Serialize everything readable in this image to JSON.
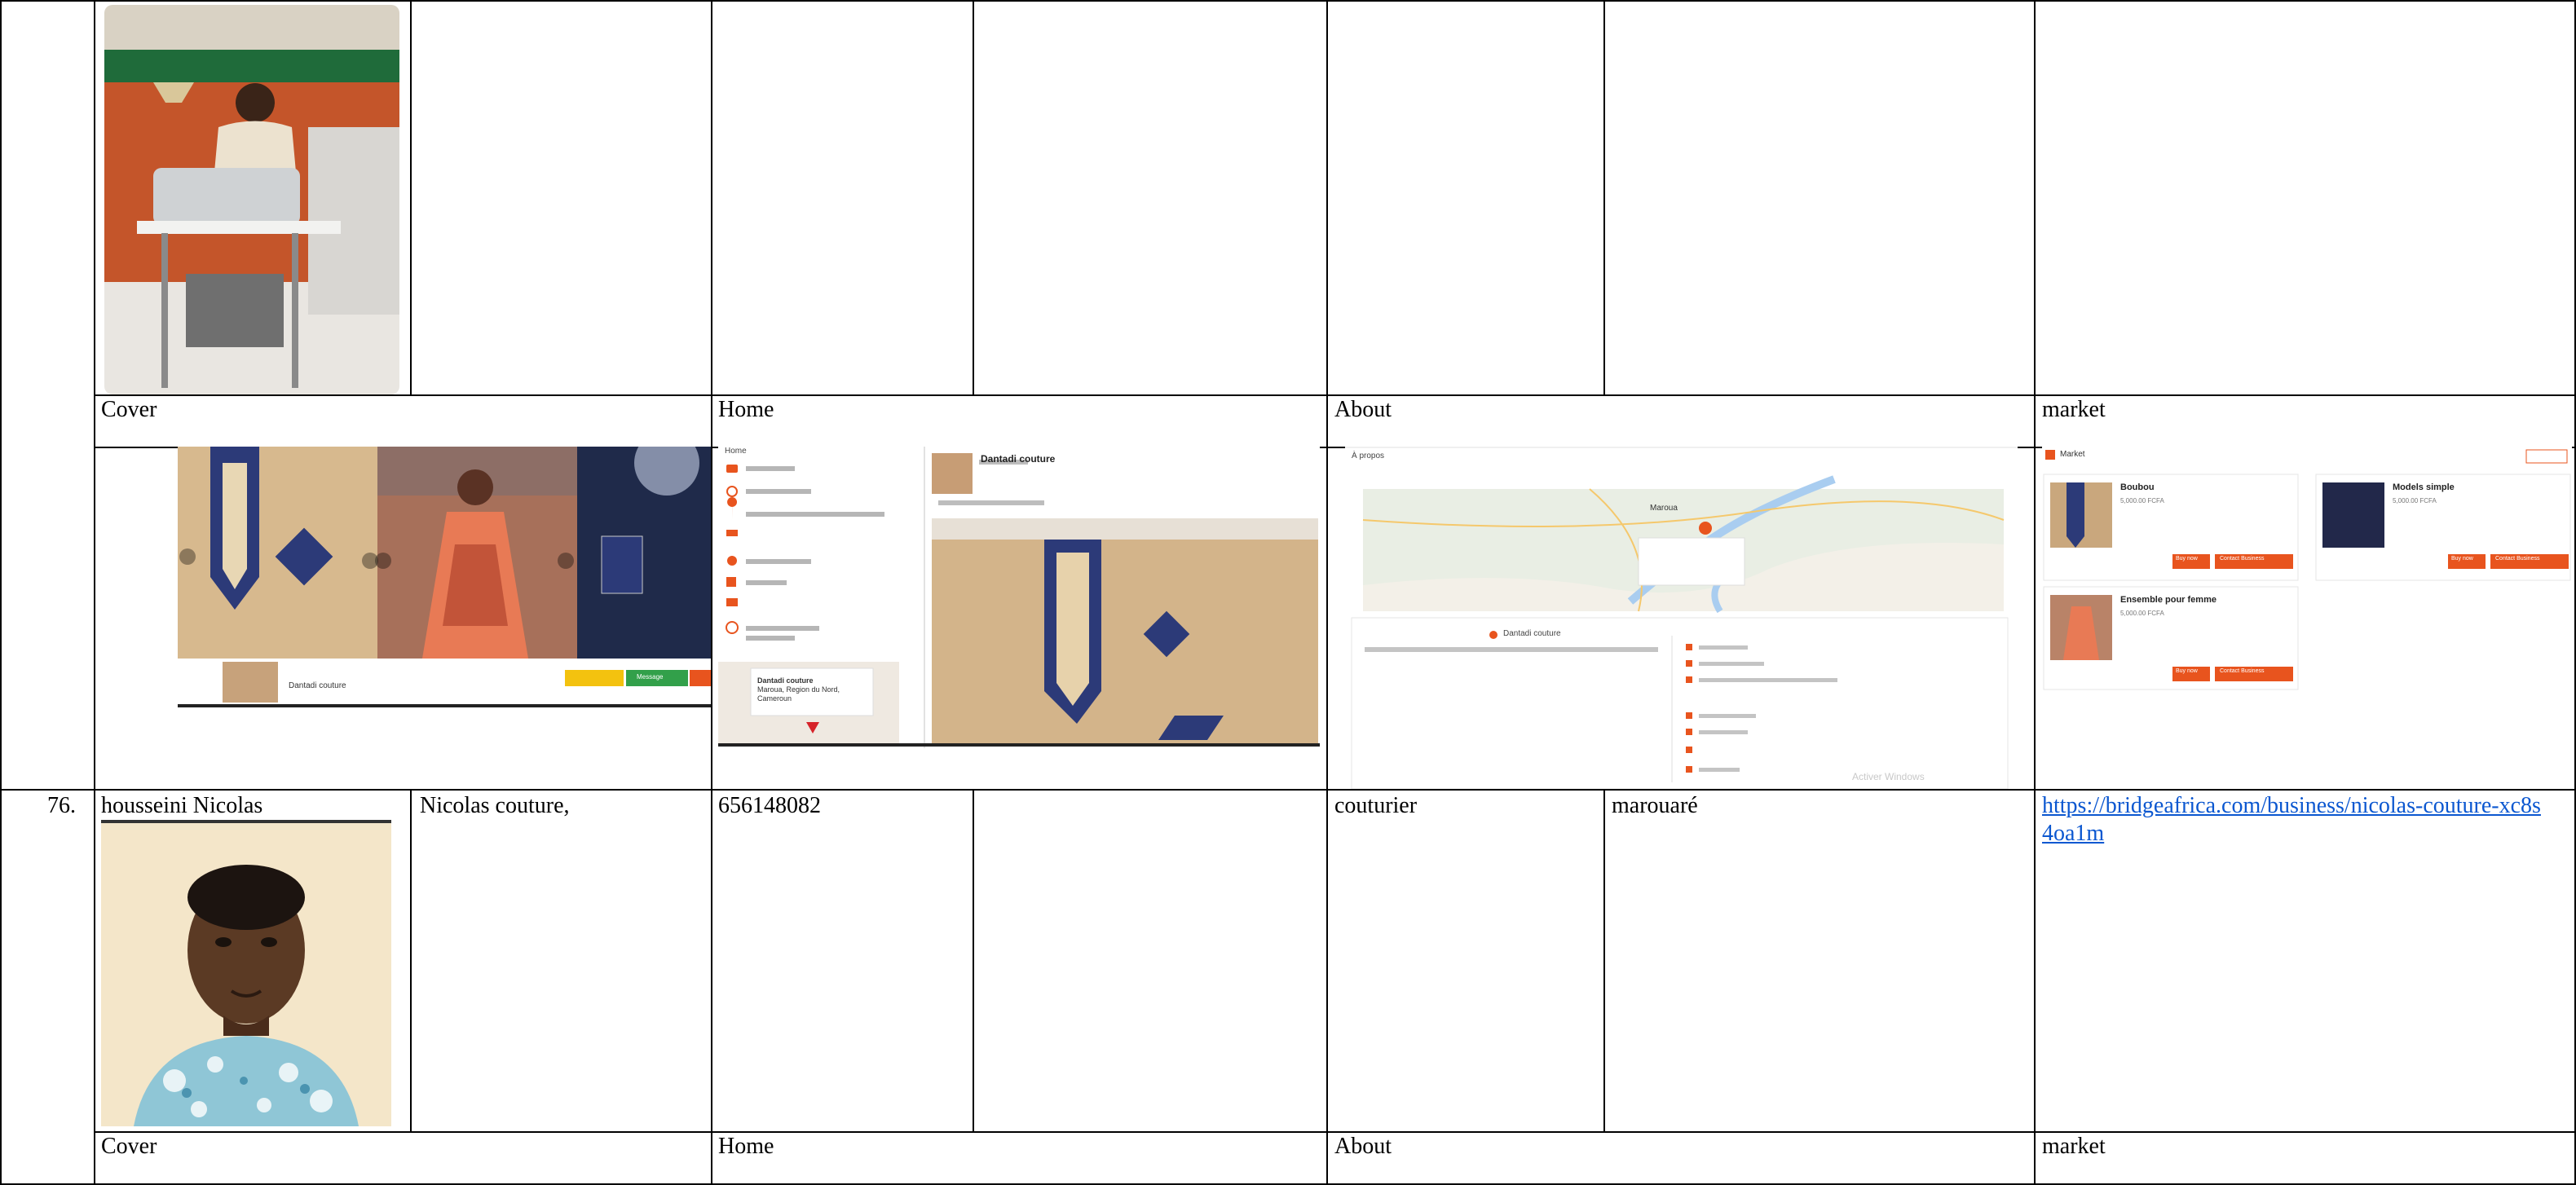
{
  "row_top": {
    "tabs": [
      "Cover",
      "Home",
      "About",
      "market"
    ],
    "cover": {
      "page_name": "Dantadi couture",
      "btn_message": "Message"
    },
    "home": {
      "sidebar_title": "Home",
      "business_name": "Dantadi couture",
      "map_card": {
        "name": "Dantadi couture",
        "address": "Maroua, Region du Nord, Cameroun"
      }
    },
    "about": {
      "header": "À propos",
      "section_title": "Dantadi couture",
      "city": "Maroua",
      "watermark": "Activer Windows"
    },
    "market": {
      "header": "Market",
      "items": [
        {
          "title": "Boubou",
          "price": "5,000.00 FCFA",
          "buy": "Buy now",
          "contact": "Contact Business"
        },
        {
          "title": "Models simple",
          "price": "5,000.00 FCFA",
          "buy": "Buy now",
          "contact": "Contact Business"
        },
        {
          "title": "Ensemble pour femme",
          "price": "5,000.00 FCFA",
          "buy": "Buy now",
          "contact": "Contact Business"
        }
      ]
    }
  },
  "row_76": {
    "number": "76.",
    "name": "housseini Nicolas",
    "business": "Nicolas couture,",
    "phone": "656148082",
    "trade": "couturier",
    "city": "marouaré",
    "url": "https://bridgeafrica.com/business/nicolas-couture-xc8s4oa1m"
  },
  "row_bottom": {
    "tabs": [
      "Cover",
      "Home",
      "About",
      "market"
    ]
  },
  "colors": {
    "accent_orange": "#e8541e",
    "link_blue": "#0b57d0",
    "map_water": "#a9cdf0",
    "fabric_navy": "#2c3a78",
    "fabric_tan": "#d7b98e"
  }
}
